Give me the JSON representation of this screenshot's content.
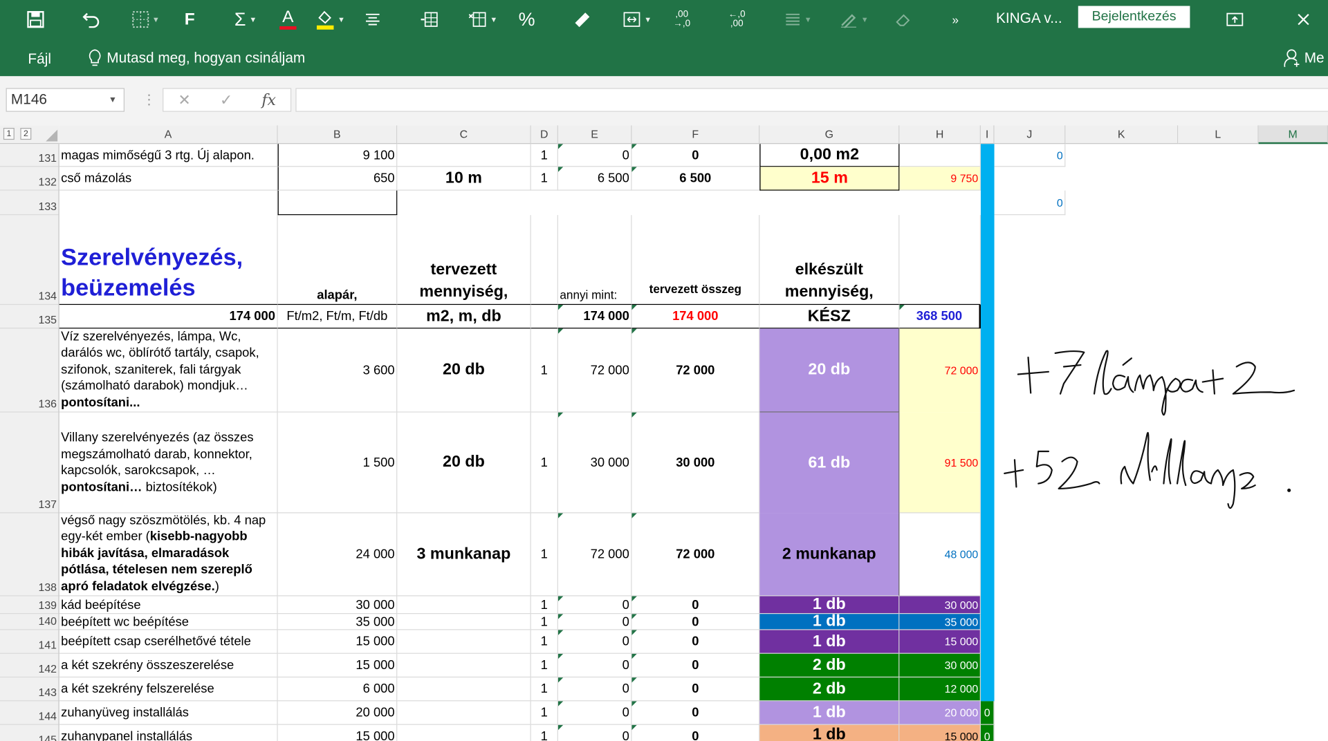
{
  "ribbon": {
    "doc_title": "KINGA v...",
    "signin_label": "Bejelentkezés",
    "file_tab": "Fájl",
    "tell_me": "Mutasd meg, hogyan csináljam",
    "share_label": "Me",
    "bold_label": "F",
    "percent_label": "%",
    "inc_decimal_label": ",00\n→,0",
    "dec_decimal_label": "←,0\n,00",
    "overflow_label": "»",
    "colors": {
      "ribbon": "#217346",
      "font_color_bar": "#e81123",
      "fill_color_bar": "#ffeb00"
    }
  },
  "formula_bar": {
    "name_box": "M146",
    "formula": ""
  },
  "columns": [
    "A",
    "B",
    "C",
    "D",
    "E",
    "F",
    "G",
    "H",
    "I",
    "J",
    "K",
    "L",
    "M"
  ],
  "selected_column": "M",
  "outline_levels": [
    "1",
    "2"
  ],
  "rows": {
    "r131": {
      "num": "131",
      "A": "magas mimőségű 3 rtg. Új alapon.",
      "B": "9 100",
      "D": "1",
      "E": "0",
      "F": "0",
      "G": "0,00  m2",
      "J": "0"
    },
    "r132": {
      "num": "132",
      "A": "cső mázolás",
      "B": "650",
      "C": "10  m",
      "D": "1",
      "E": "6 500",
      "F": "6 500",
      "G": "15  m",
      "H": "9 750"
    },
    "r133": {
      "num": "133",
      "J": "0"
    },
    "r134": {
      "num": "134",
      "A": "Szerelvényezés, beüzemelés",
      "B": "alapár,",
      "C": "tervezett mennyiség,",
      "E": "annyi mint:",
      "F": "tervezett összeg",
      "G": "elkészült mennyiség,"
    },
    "r135": {
      "num": "135",
      "A": "174 000",
      "B": "Ft/m2, Ft/m, Ft/db",
      "C": "m2, m, db",
      "E": "174 000",
      "F": "174 000",
      "G": "KÉSZ",
      "H": "368 500"
    },
    "r136": {
      "num": "136",
      "A": "Víz szerelvényezés, lámpa, Wc, darálós wc, öblírótő tartály, csapok, szifonok, szaniterek, fali tárgyak (számolható darabok) mondjuk…",
      "A_bold": "pontosítani...",
      "B": "3 600",
      "C": "20  db",
      "D": "1",
      "E": "72 000",
      "F": "72 000",
      "G": "20  db",
      "H": "72 000"
    },
    "r137": {
      "num": "137",
      "A": "Villany szerelvényezés (az összes megszámolható darab, konnektor, kapcsolók, sarokcsapok, …",
      "A_bold": "pontosítani…",
      "A_tail": "  biztosítékok)",
      "B": "1 500",
      "C": "20  db",
      "D": "1",
      "E": "30 000",
      "F": "30 000",
      "G": "61  db",
      "H": "91 500"
    },
    "r138": {
      "num": "138",
      "A": "végső nagy szöszmötölés, kb. 4 nap egy-két ember (",
      "A_bold": "kisebb-nagyobb hibák javítása, elmaradások pótlása, tételesen nem szereplő apró feladatok elvégzése.",
      "A_tail": ")",
      "B": "24 000",
      "C": "3  munkanap",
      "D": "1",
      "E": "72 000",
      "F": "72 000",
      "G": "2  munkanap",
      "H": "48 000"
    },
    "r139": {
      "num": "139",
      "A": "kád beépítése",
      "B": "30 000",
      "D": "1",
      "E": "0",
      "F": "0",
      "G": "1  db",
      "H": "30 000"
    },
    "r140": {
      "num": "140",
      "A": "beépített wc beépítése",
      "B": "35 000",
      "D": "1",
      "E": "0",
      "F": "0",
      "G": "1  db",
      "H": "35 000"
    },
    "r141": {
      "num": "141",
      "A": "beépített csap cserélhetővé tétele",
      "B": "15 000",
      "D": "1",
      "E": "0",
      "F": "0",
      "G": "1  db",
      "H": "15 000"
    },
    "r142": {
      "num": "142",
      "A": "a két szekrény összeszerelése",
      "B": "15 000",
      "D": "1",
      "E": "0",
      "F": "0",
      "G": "2  db",
      "H": "30 000"
    },
    "r143": {
      "num": "143",
      "A": "a két szekrény felszerelése",
      "B": "6 000",
      "D": "1",
      "E": "0",
      "F": "0",
      "G": "2  db",
      "H": "12 000"
    },
    "r144": {
      "num": "144",
      "A": "zuhanyüveg installálás",
      "B": "20 000",
      "D": "1",
      "E": "0",
      "F": "0",
      "G": "1  db",
      "H": "20 000",
      "I": "0"
    },
    "r145": {
      "num": "145",
      "A": "zuhanypanel installálás",
      "B": "15 000",
      "D": "1",
      "E": "0",
      "F": "0",
      "G": "1  db",
      "H": "15 000",
      "I": "0"
    }
  },
  "cell_colors": {
    "lavender": "#b193e0",
    "light_yellow": "#ffffcc",
    "purple_dark": "#7030a0",
    "blue": "#0070c0",
    "green": "#008000",
    "salmon": "#f4b183",
    "cyan_col_I": "#00b0f0",
    "blue_text": "#0000ff",
    "red_text": "#ff0000"
  },
  "handwriting": {
    "line1": "+7 lámpa +2",
    "line2": "+52 villany"
  }
}
